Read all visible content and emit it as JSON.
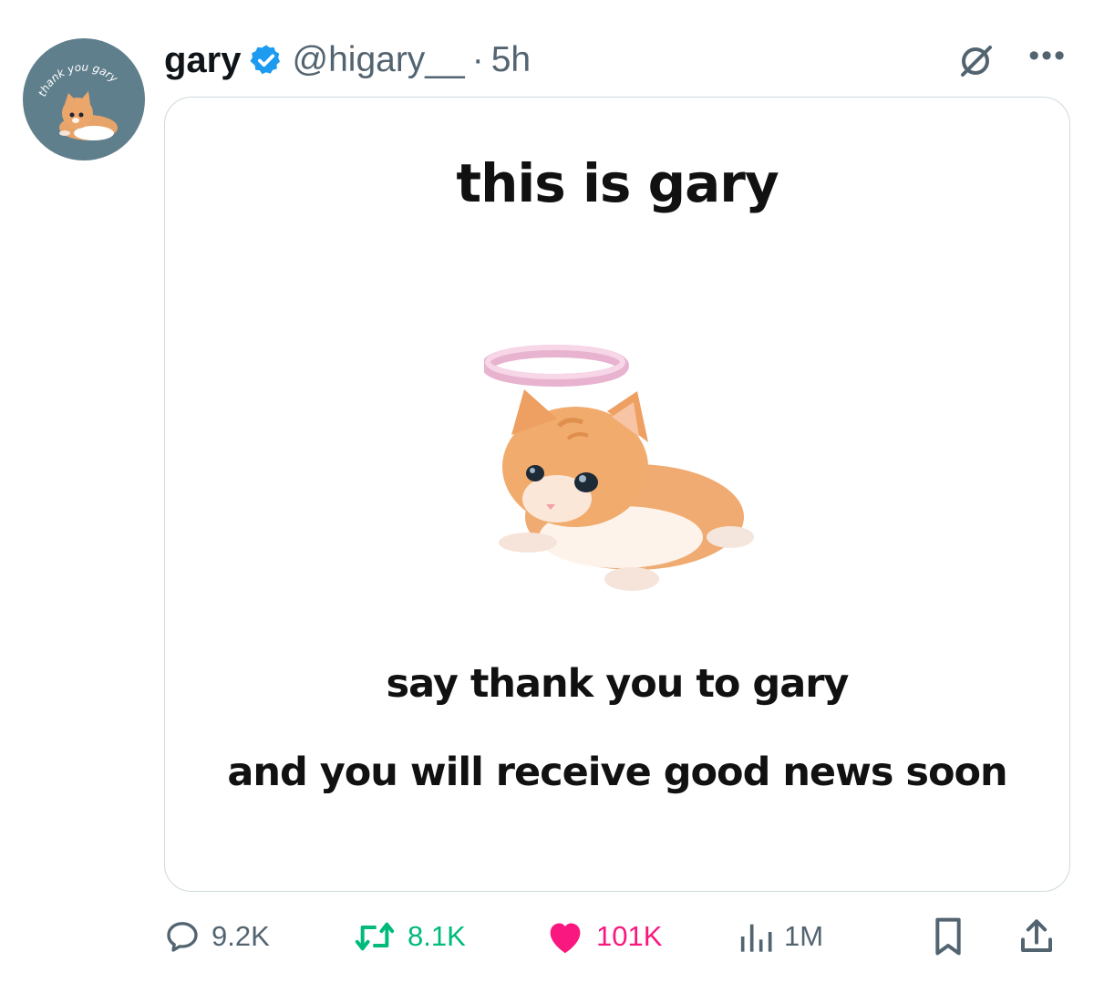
{
  "author": {
    "display_name": "gary",
    "handle": "@higary__",
    "separator": "·",
    "time": "5h",
    "verified": true,
    "avatar_text": "thank you gary"
  },
  "media": {
    "title": "this is gary",
    "line1": "say thank you to gary",
    "line2": "and you will receive good news soon"
  },
  "actions": {
    "replies": "9.2K",
    "retweets": "8.1K",
    "likes": "101K",
    "views": "1M"
  },
  "icons": {
    "reply": "reply-icon",
    "retweet": "retweet-icon",
    "like": "heart-icon",
    "views": "views-icon",
    "bookmark": "bookmark-icon",
    "share": "share-icon",
    "more": "more-icon",
    "grok": "grok-icon",
    "verified": "verified-badge-icon"
  },
  "colors": {
    "verified_blue": "#1d9bf0",
    "retweet_green": "#00ba7c",
    "like_pink": "#f91880",
    "muted_gray": "#536471",
    "avatar_bg": "#5f7f8c"
  }
}
